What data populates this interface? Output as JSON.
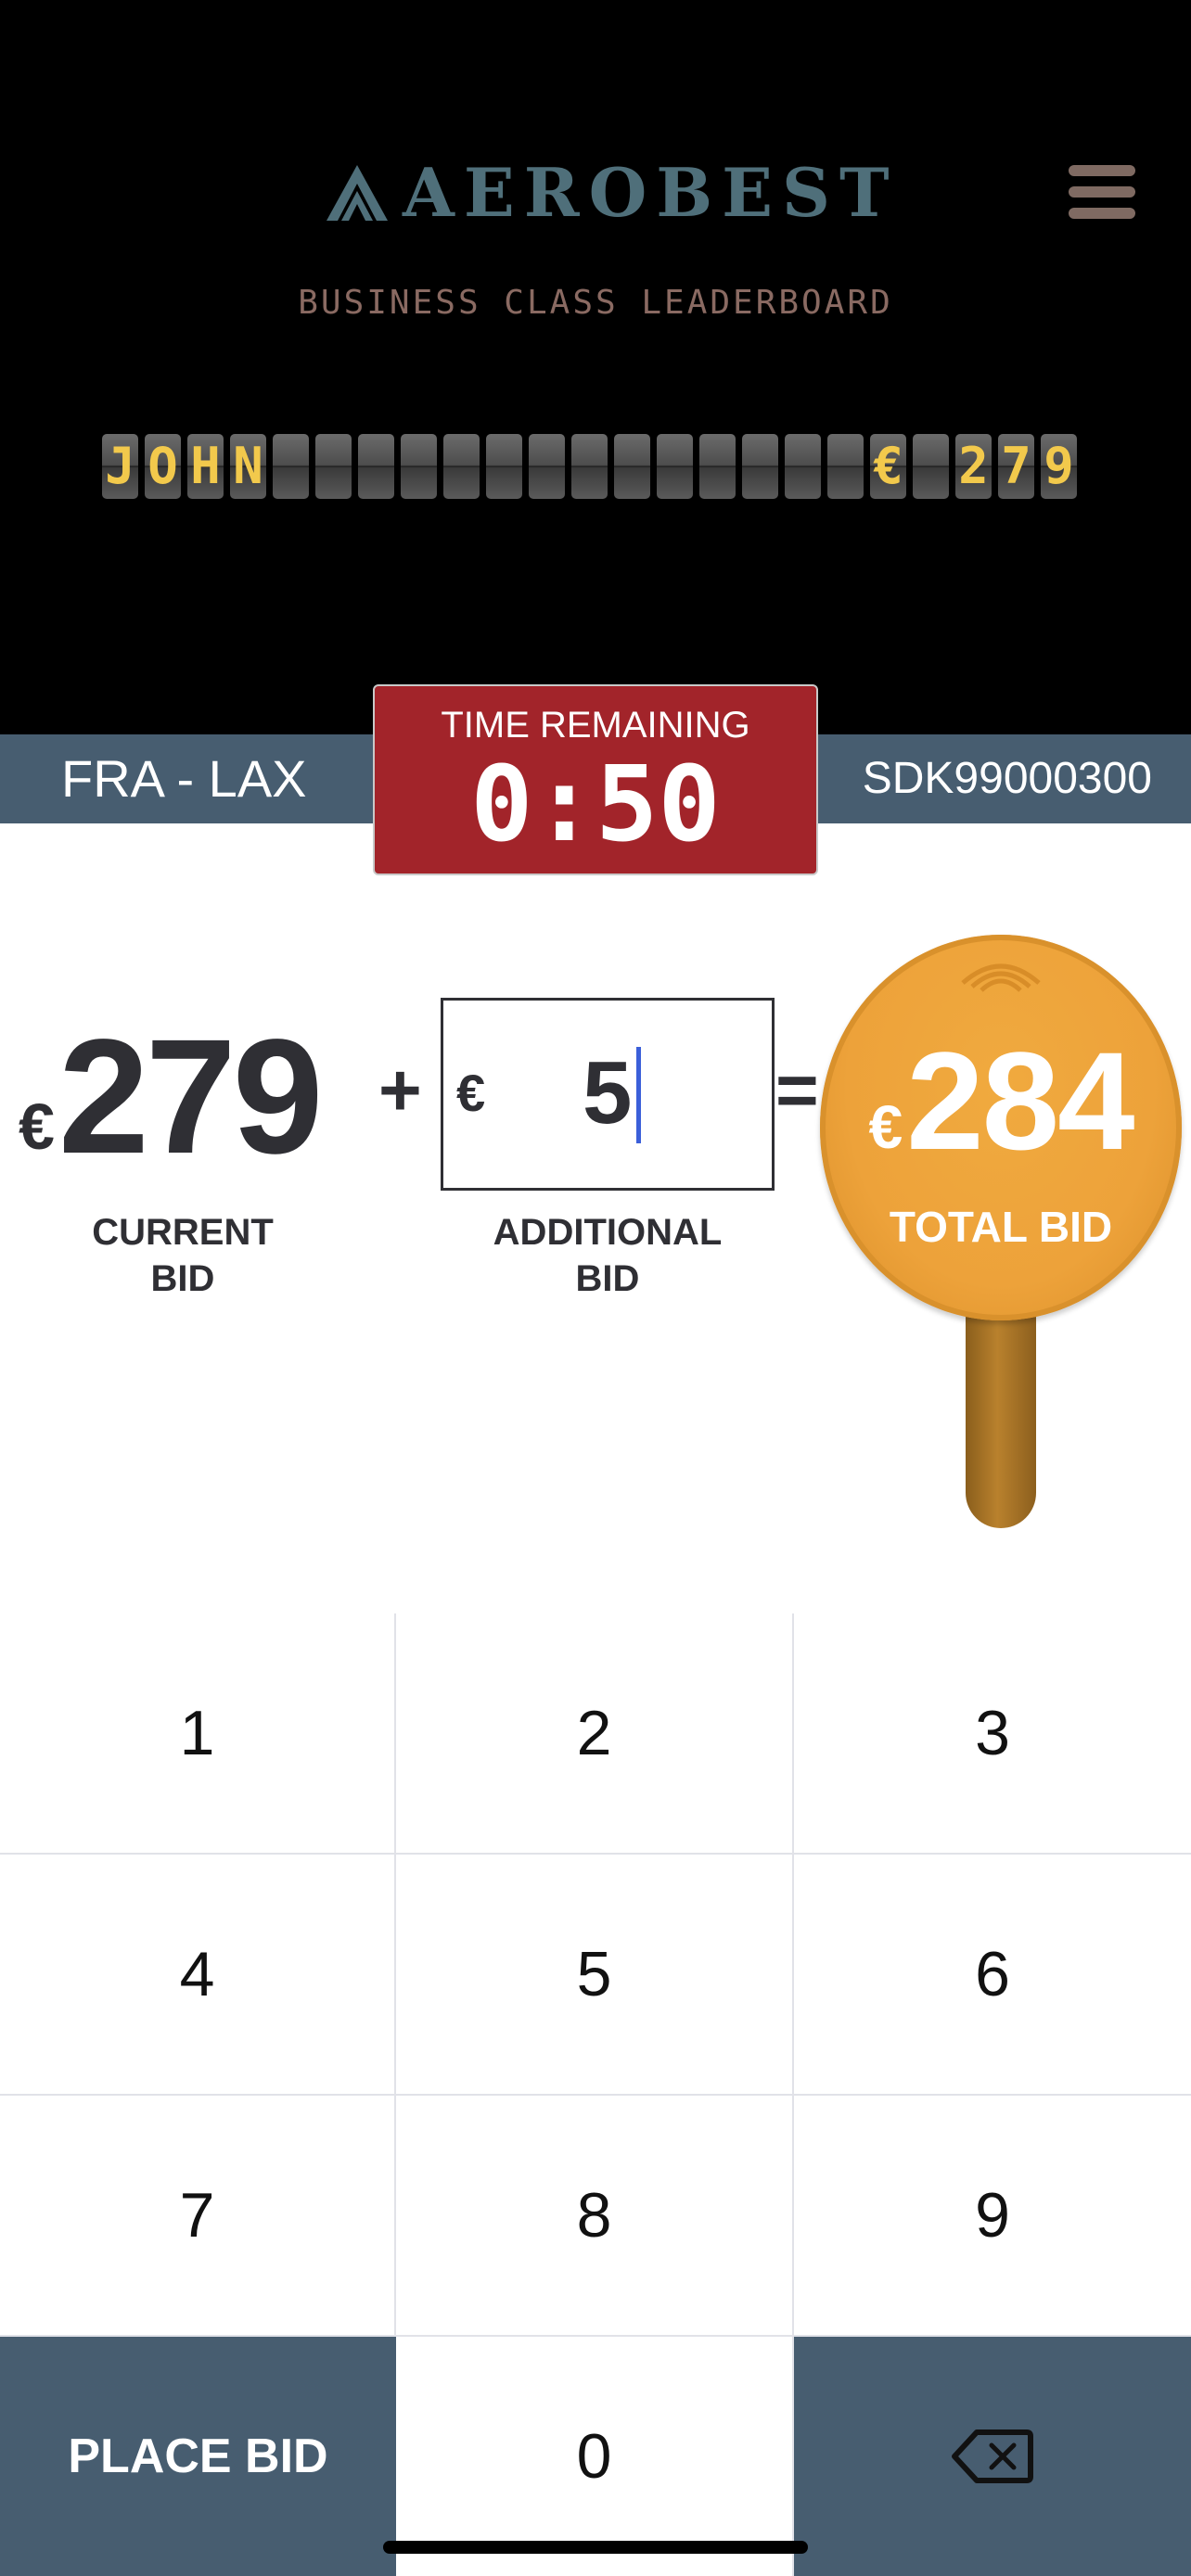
{
  "header": {
    "brand": "AEROBEST",
    "subtitle": "BUSINESS CLASS LEADERBOARD",
    "leader_flaps": [
      "J",
      "O",
      "H",
      "N",
      "",
      "",
      "",
      "",
      "",
      "",
      "",
      "",
      "",
      "",
      "",
      "",
      "",
      "",
      "€",
      "",
      "2",
      "7",
      "9"
    ]
  },
  "route_bar": {
    "route": "FRA - LAX",
    "flight_code": "SDK99000300"
  },
  "timer": {
    "label": "TIME REMAINING",
    "value": "0:50"
  },
  "bid": {
    "currency": "€",
    "current_value": "279",
    "current_label_line1": "CURRENT",
    "current_label_line2": "BID",
    "plus": "+",
    "additional_value": "5",
    "additional_label_line1": "ADDITIONAL",
    "additional_label_line2": "BID",
    "equals": "=",
    "total_value": "284",
    "total_label": "TOTAL BID"
  },
  "keypad": {
    "keys": [
      "1",
      "2",
      "3",
      "4",
      "5",
      "6",
      "7",
      "8",
      "9"
    ],
    "place_bid_label": "PLACE BID",
    "zero": "0"
  },
  "colors": {
    "header_bg": "#000000",
    "brand": "#4f6f7a",
    "flap_text": "#f2c94c",
    "route_bar": "#475d70",
    "timer_bg": "#a2242a",
    "paddle": "#eda23a",
    "caret": "#3b5fd9"
  }
}
